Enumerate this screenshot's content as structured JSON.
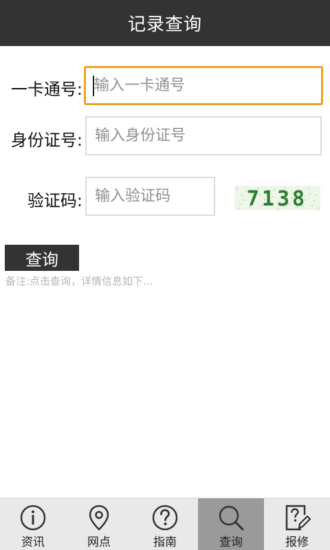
{
  "header": {
    "title": "记录查询"
  },
  "form": {
    "card_label": "一卡通号:",
    "card_placeholder": "输入一卡通号",
    "id_label": "身份证号:",
    "id_placeholder": "输入身份证号",
    "code_label": "验证码:",
    "code_placeholder": "输入验证码",
    "captcha_text": "7138"
  },
  "actions": {
    "query_label": "查询"
  },
  "note": {
    "text": "备注:点击查询，详情信息如下..."
  },
  "nav": {
    "items": [
      {
        "label": "资讯",
        "icon": "info-icon"
      },
      {
        "label": "网点",
        "icon": "location-pin-icon"
      },
      {
        "label": "指南",
        "icon": "help-icon"
      },
      {
        "label": "查询",
        "icon": "search-icon",
        "active": true
      },
      {
        "label": "报修",
        "icon": "edit-report-icon"
      }
    ]
  },
  "colors": {
    "title_bar": "#333333",
    "focus_border": "#f0a020",
    "captcha_green": "#2e7d32",
    "nav_active": "#9a9a9a"
  }
}
